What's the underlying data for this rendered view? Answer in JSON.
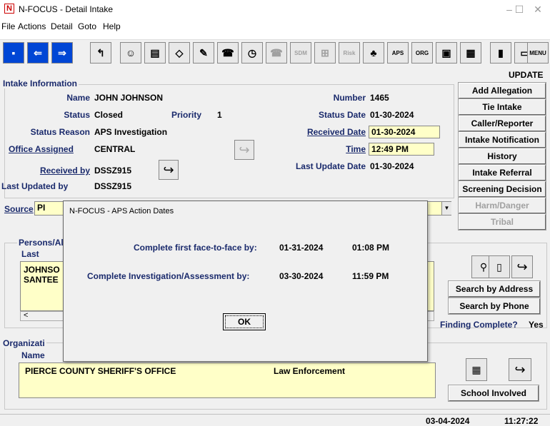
{
  "window": {
    "title": "N-FOCUS - Detail Intake",
    "app_icon": "N",
    "minimize": "–",
    "maximize": "☐",
    "close": "✕"
  },
  "menu": [
    "File",
    "Actions",
    "Detail",
    "Goto",
    "Help"
  ],
  "toolbar": {
    "aps": "APS",
    "org": "ORG",
    "sdm": "SDM",
    "risk": "Risk",
    "menu": "MENU"
  },
  "mode": "UPDATE",
  "right_buttons": [
    {
      "label": "Add Allegation",
      "enabled": true
    },
    {
      "label": "Tie Intake",
      "enabled": true
    },
    {
      "label": "Caller/Reporter",
      "enabled": true
    },
    {
      "label": "Intake Notification",
      "enabled": true
    },
    {
      "label": "History",
      "enabled": true
    },
    {
      "label": "Intake Referral",
      "enabled": true
    },
    {
      "label": "Screening Decision",
      "enabled": true
    },
    {
      "label": "Harm/Danger",
      "enabled": false
    },
    {
      "label": "Tribal",
      "enabled": false
    }
  ],
  "intake": {
    "legend": "Intake Information",
    "name_label": "Name",
    "name": "JOHN JOHNSON",
    "number_label": "Number",
    "number": "1465",
    "status_label": "Status",
    "status": "Closed",
    "priority_label": "Priority",
    "priority": "1",
    "status_date_label": "Status Date",
    "status_date": "01-30-2024",
    "status_reason_label": "Status Reason",
    "status_reason": "APS Investigation",
    "received_date_label": "Received Date",
    "received_date": "01-30-2024",
    "office_label": "Office Assigned",
    "office": "CENTRAL",
    "time_label": "Time",
    "time": "12:49 PM",
    "received_by_label": "Received by",
    "received_by": "DSSZ915",
    "last_update_label": "Last Update Date",
    "last_update": "01-30-2024",
    "last_updated_by_label": "Last Updated by",
    "last_updated_by": "DSSZ915",
    "source_label": "Source",
    "source_partial": "PI"
  },
  "persons": {
    "legend_partial": "Persons/Al",
    "col_last": "Last",
    "rows": [
      "JOHNSO",
      "SANTEE"
    ],
    "search_address": "Search by Address",
    "search_phone": "Search by Phone",
    "finding_label": "Finding Complete?",
    "finding_value": "Yes"
  },
  "organization": {
    "legend_partial": "Organizati",
    "col_name": "Name",
    "row_name": "PIERCE COUNTY SHERIFF'S OFFICE",
    "row_type": "Law Enforcement",
    "school_button": "School Involved"
  },
  "dialog": {
    "title": "N-FOCUS - APS Action Dates",
    "line1_label": "Complete first face-to-face by:",
    "line1_date": "01-31-2024",
    "line1_time": "01:08 PM",
    "line2_label": "Complete Investigation/Assessment by:",
    "line2_date": "03-30-2024",
    "line2_time": "11:59 PM",
    "ok": "OK"
  },
  "status": {
    "date": "03-04-2024",
    "time": "11:27:22"
  },
  "icons": {
    "arrow": "↪",
    "back": "↰",
    "scroll_left": "<",
    "dropdown": "▼"
  }
}
